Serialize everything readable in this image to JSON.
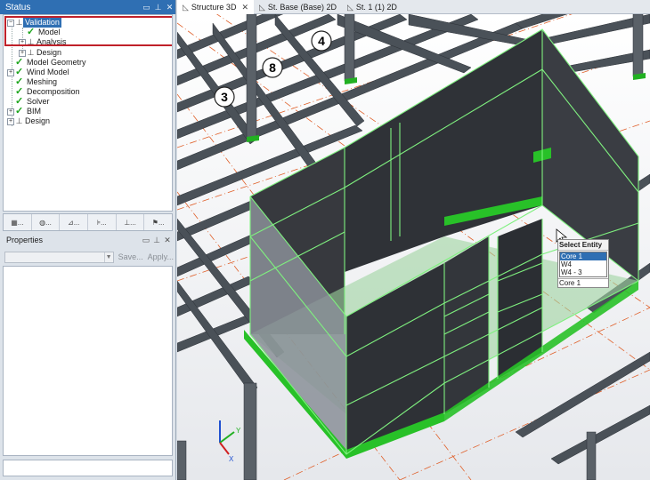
{
  "status_panel": {
    "title": "Status"
  },
  "tree": [
    {
      "label": "Validation",
      "icon": "pin-icon",
      "expander": "-",
      "selected": true
    },
    {
      "label": "Model",
      "icon": "check-icon"
    },
    {
      "label": "Analysis",
      "icon": "pin-icon",
      "expander": "+"
    },
    {
      "label": "Design",
      "icon": "pin-icon",
      "expander": "+"
    },
    {
      "label": "Model Geometry",
      "icon": "check-icon"
    },
    {
      "label": "Wind Model",
      "icon": "check-icon",
      "expander": "+"
    },
    {
      "label": "Meshing",
      "icon": "check-icon"
    },
    {
      "label": "Decomposition",
      "icon": "check-icon"
    },
    {
      "label": "Solver",
      "icon": "check-icon"
    },
    {
      "label": "BIM",
      "icon": "check-icon",
      "expander": "+"
    },
    {
      "label": "Design",
      "icon": "pin-icon",
      "expander": "+"
    }
  ],
  "toolbar": {
    "buttons": [
      "...",
      "...",
      "...",
      "...",
      "...",
      "..."
    ]
  },
  "properties_panel": {
    "title": "Properties",
    "save_label": "Save...",
    "apply_label": "Apply..."
  },
  "tabs": [
    {
      "label": "Structure 3D",
      "active": true,
      "closable": true
    },
    {
      "label": "St. Base (Base) 2D"
    },
    {
      "label": "St. 1 (1) 2D"
    }
  ],
  "view": {
    "grid_labels": [
      "4",
      "8",
      "3"
    ],
    "axis_labels": [
      "Y",
      "X"
    ]
  },
  "select_entity": {
    "title": "Select Entity",
    "items": [
      "Core 1",
      "W4",
      "W4 - 3"
    ],
    "selected_index": 0,
    "current": "Core 1"
  },
  "colors": {
    "accent": "#2f6fb3",
    "highlight": "#c0212a",
    "selection_green": "#6ee66e",
    "support_green": "#22b022"
  }
}
